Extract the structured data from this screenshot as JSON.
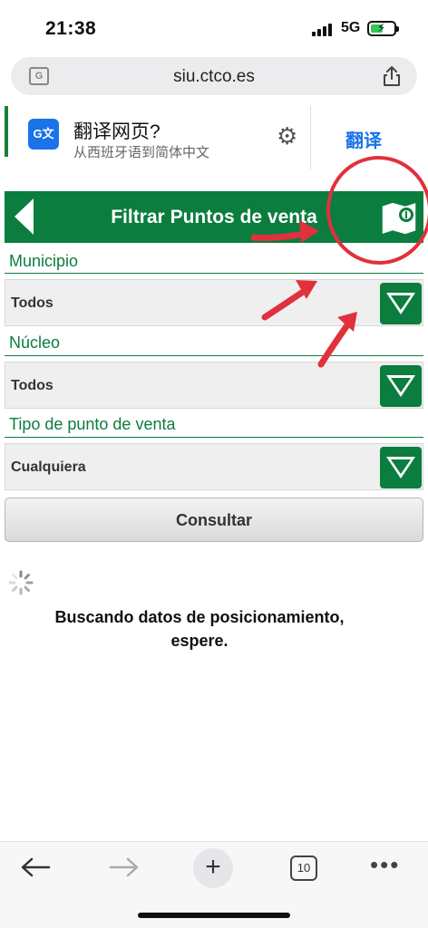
{
  "status": {
    "time": "21:38",
    "network": "5G"
  },
  "browser": {
    "url": "siu.ctco.es",
    "tab_count": "10"
  },
  "translate_banner": {
    "title": "翻译网页?",
    "subtitle": "从西班牙语到简体中文",
    "action": "翻译"
  },
  "header": {
    "title": "Filtrar Puntos de venta"
  },
  "filters": [
    {
      "label": "Municipio",
      "value": "Todos"
    },
    {
      "label": "Núcleo",
      "value": "Todos"
    },
    {
      "label": "Tipo de punto de venta",
      "value": "Cualquiera"
    }
  ],
  "consult_button": "Consultar",
  "loading_message": "Buscando datos de posicionamiento, espere.",
  "colors": {
    "brand_green": "#0b7d3e",
    "link_blue": "#1a73e8",
    "annotation_red": "#e0313c"
  },
  "icons": [
    "signal-icon",
    "battery-icon",
    "translate-icon",
    "share-icon",
    "gear-icon",
    "back-arrow-icon",
    "map-icon",
    "dropdown-arrow-icon",
    "spinner-icon",
    "plus-icon",
    "more-icon"
  ]
}
